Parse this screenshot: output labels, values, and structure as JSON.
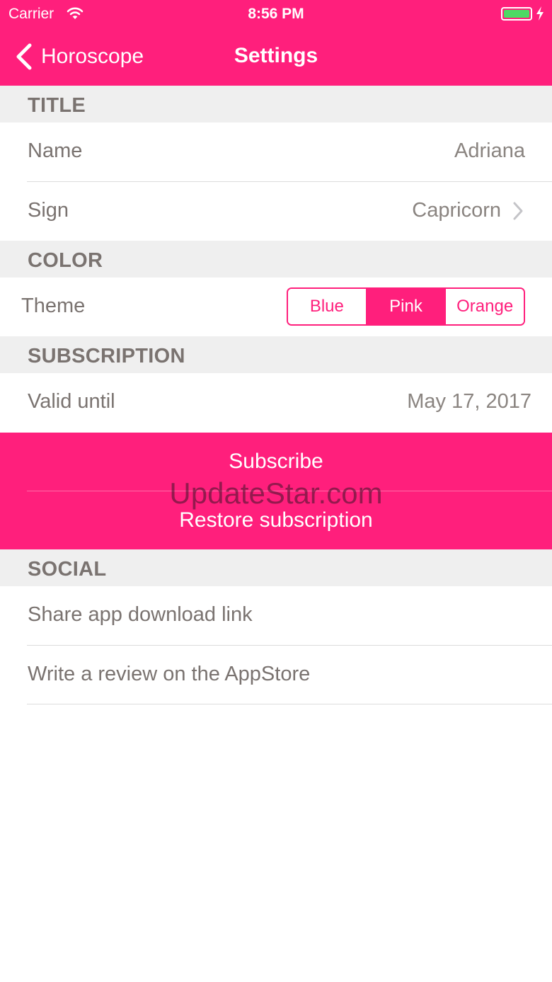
{
  "status_bar": {
    "carrier": "Carrier",
    "time": "8:56 PM"
  },
  "nav": {
    "back_label": "Horoscope",
    "title": "Settings"
  },
  "sections": {
    "title": "TITLE",
    "color": "COLOR",
    "subscription": "SUBSCRIPTION",
    "social": "SOCIAL"
  },
  "profile": {
    "name_label": "Name",
    "name_value": "Adriana",
    "sign_label": "Sign",
    "sign_value": "Capricorn"
  },
  "theme": {
    "label": "Theme",
    "options": [
      "Blue",
      "Pink",
      "Orange"
    ],
    "selected": "Pink"
  },
  "subscription": {
    "valid_label": "Valid until",
    "valid_value": "May 17, 2017",
    "subscribe_label": "Subscribe",
    "restore_label": "Restore subscription"
  },
  "watermark": "UpdateStar.com",
  "social": {
    "share_label": "Share app download link",
    "review_label": "Write a review on the AppStore"
  },
  "colors": {
    "accent": "#ff1f7c",
    "section_bg": "#efefef",
    "text": "#7a7370",
    "battery": "#4cd964"
  },
  "icons": {
    "back": "chevron-left-icon",
    "disclosure": "chevron-right-icon",
    "wifi": "wifi-icon",
    "battery": "battery-icon",
    "charging": "bolt-icon"
  }
}
